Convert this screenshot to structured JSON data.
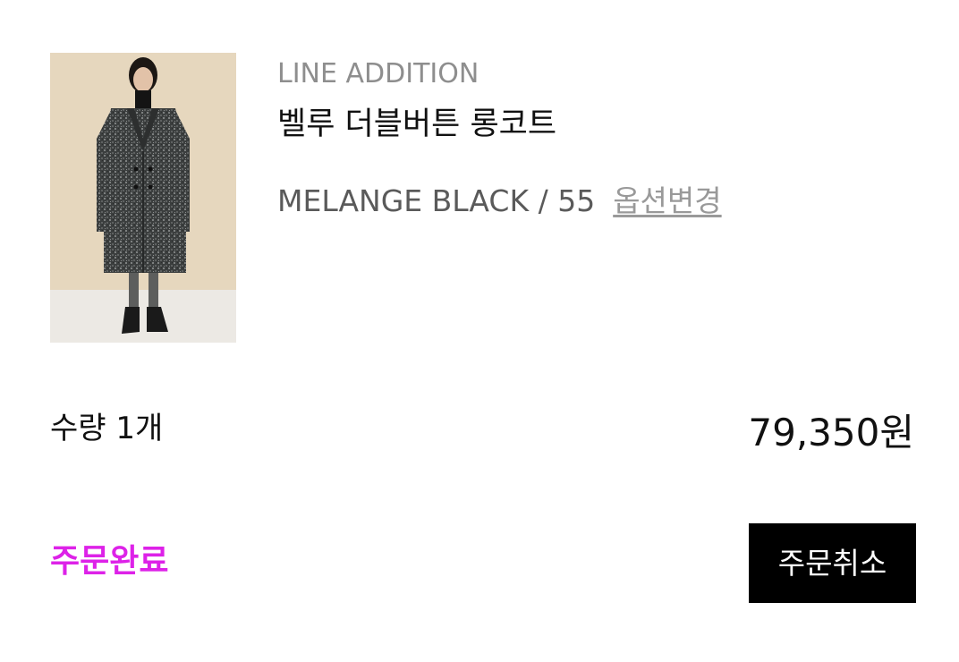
{
  "product": {
    "brand": "LINE ADDITION",
    "name": "벨루 더블버튼 롱코트",
    "option": "MELANGE BLACK / 55",
    "option_change_label": "옵션변경",
    "image_alt": "벨루 더블버튼 롱코트 product photo"
  },
  "order": {
    "quantity_label": "수량 1개",
    "price": "79,350원",
    "status": "주문완료",
    "cancel_label": "주문취소"
  },
  "colors": {
    "status": "#dd22e8",
    "button_bg": "#000000",
    "button_text": "#ffffff",
    "brand_text": "#8e8e8e",
    "option_text": "#5a5a5a",
    "link_text": "#999999"
  }
}
